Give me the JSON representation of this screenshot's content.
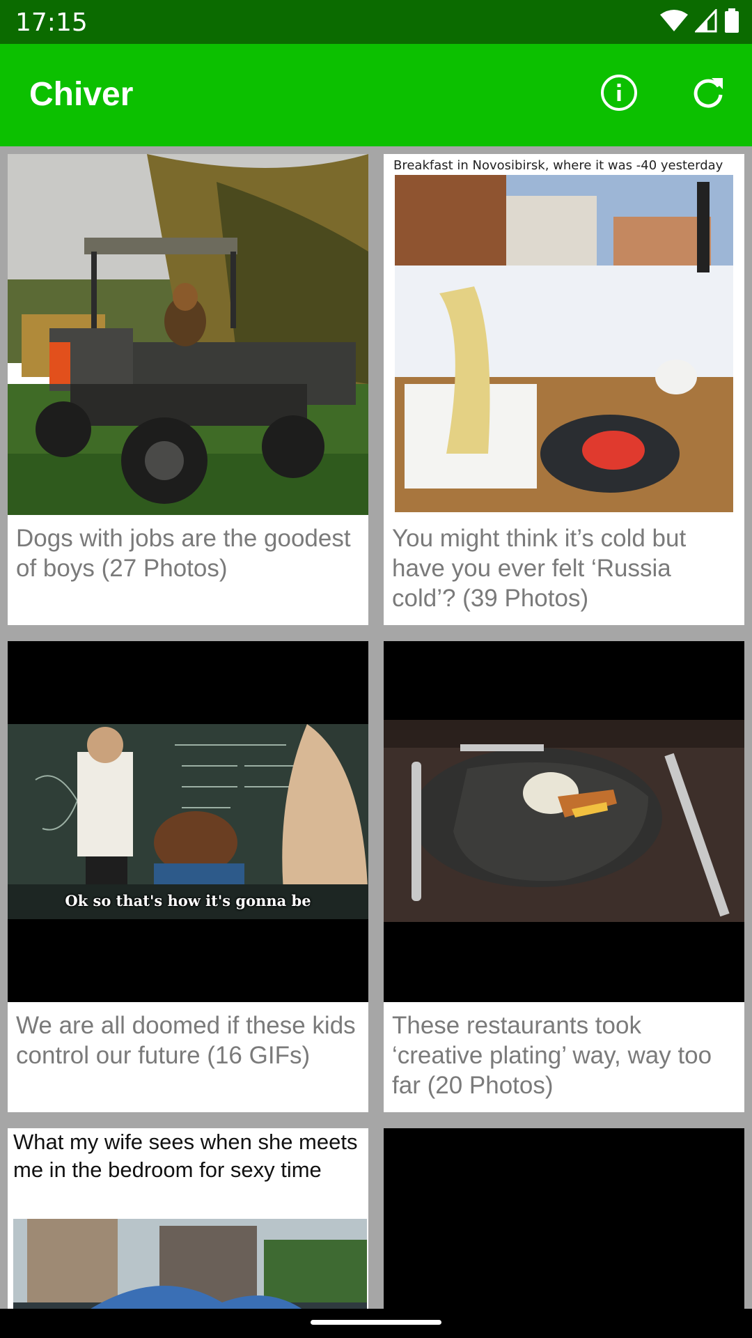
{
  "status_bar": {
    "time": "17:15",
    "icons": [
      "wifi-icon",
      "signal-icon",
      "battery-icon"
    ]
  },
  "app_bar": {
    "title": "Chiver",
    "actions": [
      "info-icon",
      "refresh-icon"
    ],
    "color": "#0cc000"
  },
  "posts": [
    {
      "caption": "Dogs with jobs are the goodest of boys (27 Photos)"
    },
    {
      "caption": "You might think it’s cold but have you ever felt ‘Russia cold’? (39 Photos)",
      "image_text": "Breakfast in Novosibirsk, where it was -40 yesterday"
    },
    {
      "caption": "We are all doomed if these kids control our future (16 GIFs)",
      "image_text": "Ok so that's how it's gonna be"
    },
    {
      "caption": "These restaurants took ‘creative plating’ way, way too far (20 Photos)"
    },
    {
      "caption": "",
      "image_text": "What my wife sees when she meets me in the bedroom for sexy time"
    },
    {
      "caption": ""
    }
  ]
}
